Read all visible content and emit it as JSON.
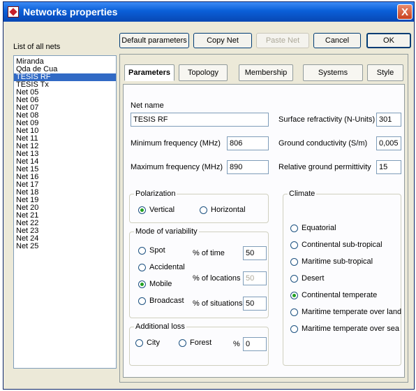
{
  "window": {
    "title": "Networks properties",
    "close_glyph": "X"
  },
  "netlist": {
    "label": "List of all nets",
    "items": [
      "Miranda",
      "Qda de Cua",
      "TESIS RF",
      "TESIS Tx",
      "Net 05",
      "Net 06",
      "Net 07",
      "Net 08",
      "Net 09",
      "Net 10",
      "Net 11",
      "Net 12",
      "Net 13",
      "Net 14",
      "Net 15",
      "Net 16",
      "Net 17",
      "Net 18",
      "Net 19",
      "Net 20",
      "Net 21",
      "Net 22",
      "Net 23",
      "Net 24",
      "Net 25"
    ],
    "selected_index": 2
  },
  "toolbar": {
    "default_params": "Default parameters",
    "copy_net": "Copy Net",
    "paste_net": "Paste Net",
    "cancel": "Cancel",
    "ok": "OK"
  },
  "tabs": [
    {
      "label": "Parameters",
      "active": true
    },
    {
      "label": "Topology",
      "active": false
    },
    {
      "label": "Membership",
      "active": false
    },
    {
      "label": "Systems",
      "active": false
    },
    {
      "label": "Style",
      "active": false
    }
  ],
  "params": {
    "net_name_label": "Net name",
    "net_name": "TESIS RF",
    "min_freq_label": "Minimum frequency (MHz)",
    "min_freq": "806",
    "max_freq_label": "Maximum frequency (MHz)",
    "max_freq": "890",
    "refractivity_label": "Surface refractivity (N-Units)",
    "refractivity": "301",
    "conductivity_label": "Ground conductivity (S/m)",
    "conductivity": "0,005",
    "permittivity_label": "Relative ground permittivity",
    "permittivity": "15"
  },
  "polarization": {
    "title": "Polarization",
    "options": [
      "Vertical",
      "Horizontal"
    ],
    "selected": "Vertical"
  },
  "variability": {
    "title": "Mode of variability",
    "options": [
      "Spot",
      "Accidental",
      "Mobile",
      "Broadcast"
    ],
    "selected": "Mobile",
    "time_label": "% of time",
    "time": "50",
    "locations_label": "% of locations",
    "locations": "50",
    "situations_label": "% of situations",
    "situations": "50"
  },
  "loss": {
    "title": "Additional loss",
    "options": [
      "City",
      "Forest"
    ],
    "percent_label": "%",
    "percent": "0"
  },
  "climate": {
    "title": "Climate",
    "options": [
      "Equatorial",
      "Continental sub-tropical",
      "Maritime sub-tropical",
      "Desert",
      "Continental temperate",
      "Maritime temperate over land",
      "Maritime temperate over sea"
    ],
    "selected": "Continental temperate"
  }
}
